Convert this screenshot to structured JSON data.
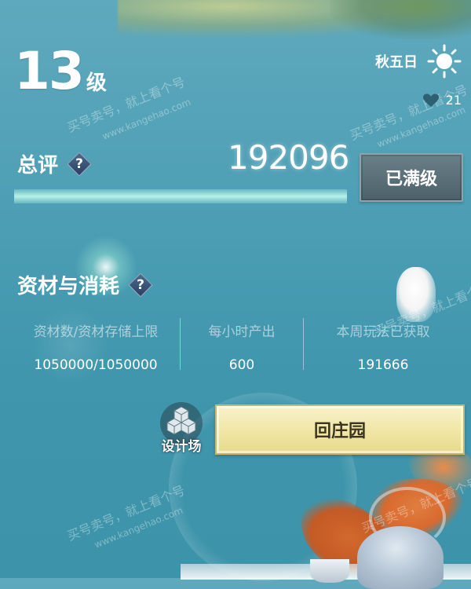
{
  "header": {
    "level": "13",
    "level_unit": "级",
    "day": "秋五日",
    "hearts": "21"
  },
  "rating": {
    "title": "总评",
    "help": "?",
    "score": "192096",
    "max_button": "已满级",
    "progress_fraction": 1.0
  },
  "resources": {
    "title": "资材与消耗",
    "help": "?",
    "stats": [
      {
        "label": "资材数/资材存储上限",
        "value": "1050000/1050000"
      },
      {
        "label": "每小时产出",
        "value": "600"
      },
      {
        "label": "本周玩法已获取",
        "value": "191666"
      }
    ]
  },
  "actions": {
    "design_label": "设计场",
    "home_button": "回庄园"
  },
  "watermark": {
    "text": "买号卖号，就上看个号",
    "url": "www.kangehao.com"
  }
}
